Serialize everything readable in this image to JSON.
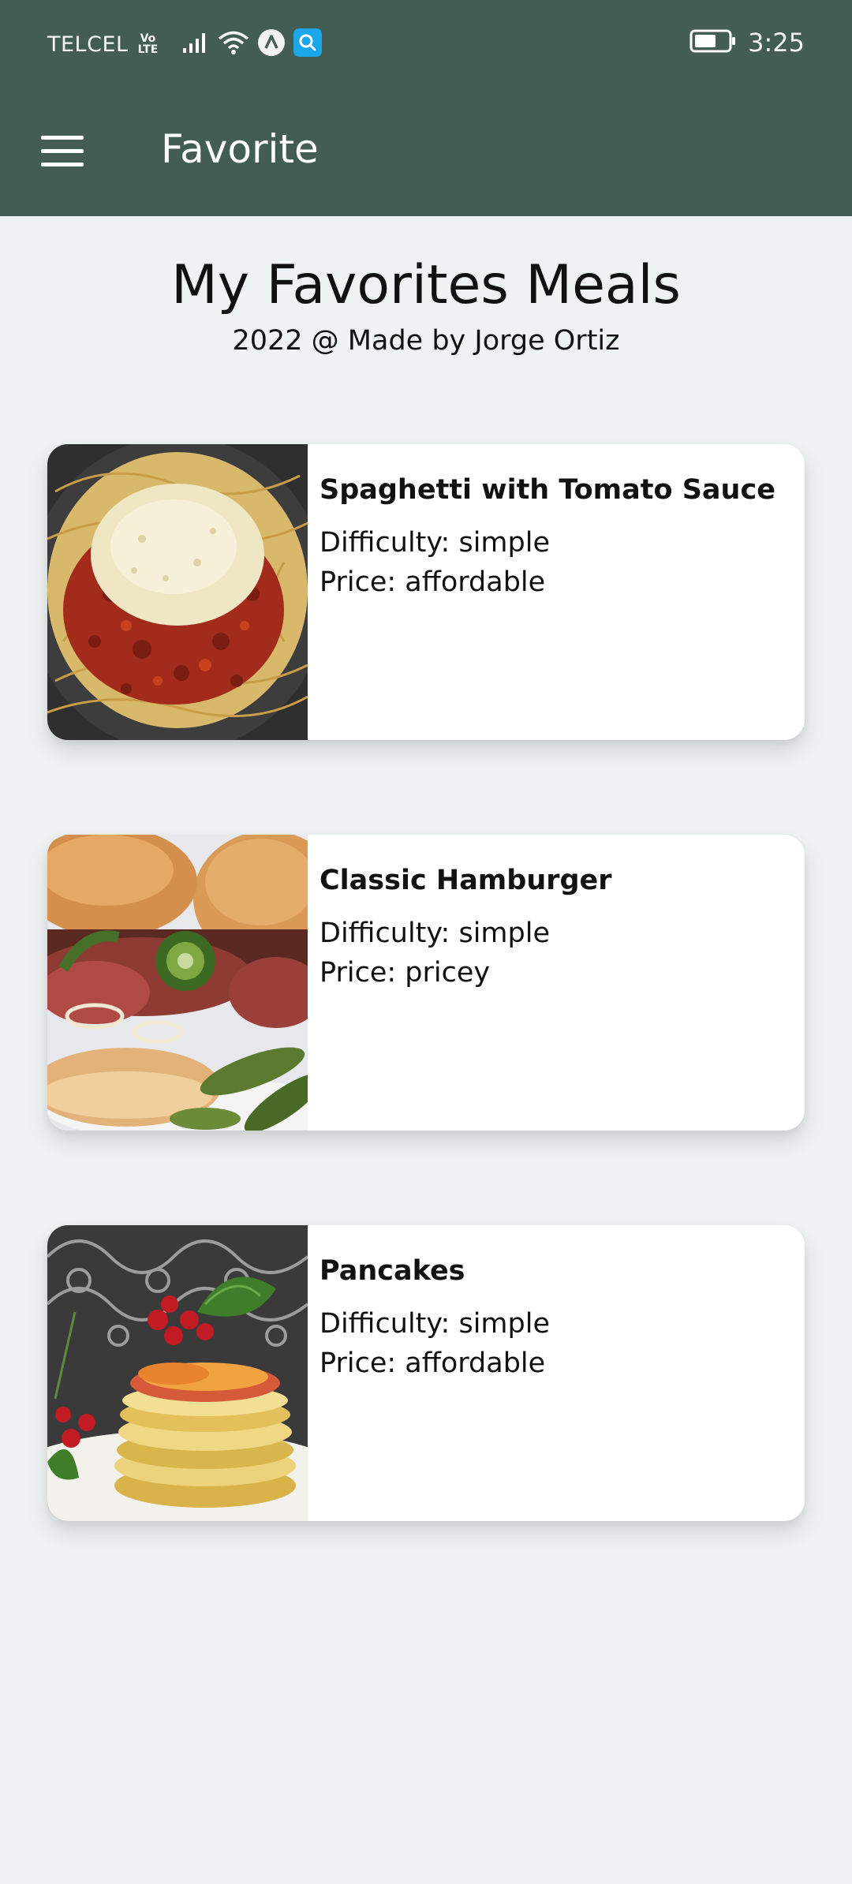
{
  "status_bar": {
    "carrier": "TELCEL",
    "volte_top": "Vo",
    "volte_bottom": "LTE",
    "time": "3:25",
    "icons": [
      "signal-icon",
      "wifi-icon",
      "app-notification-icon",
      "search-app-icon",
      "battery-icon"
    ]
  },
  "app_bar": {
    "menu_icon": "hamburger-menu-icon",
    "title": "Favorite"
  },
  "header": {
    "title": "My Favorites Meals",
    "subtitle": "2022 @ Made by Jorge Ortiz"
  },
  "meals": [
    {
      "title": "Spaghetti with Tomato Sauce",
      "difficulty": "Difficulty: simple",
      "price": "Price: affordable",
      "image": "spaghetti-photo"
    },
    {
      "title": "Classic Hamburger",
      "difficulty": "Difficulty: simple",
      "price": "Price: pricey",
      "image": "hamburger-photo"
    },
    {
      "title": "Pancakes",
      "difficulty": "Difficulty: simple",
      "price": "Price: affordable",
      "image": "pancakes-photo"
    }
  ],
  "colors": {
    "app_bar": "#435d55",
    "background": "#eef2f2",
    "card": "#ffffff"
  }
}
